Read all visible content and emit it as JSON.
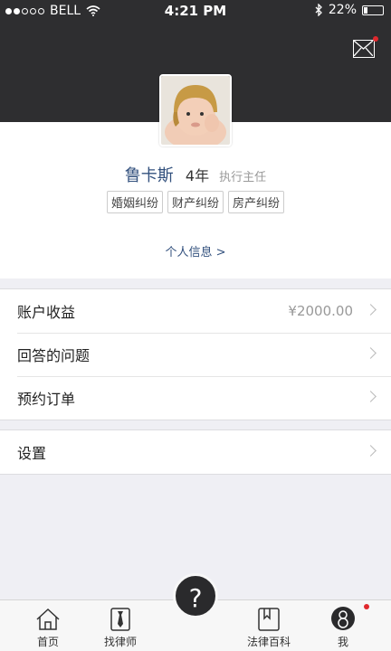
{
  "status_bar": {
    "carrier": "BELL",
    "time": "4:21 PM",
    "battery": "22%"
  },
  "header": {
    "mail_icon": "envelope-icon"
  },
  "profile": {
    "name": "鲁卡斯",
    "years": "4年",
    "title": "执行主任",
    "tags": [
      "婚姻纠纷",
      "财产纠纷",
      "房产纠纷"
    ],
    "info_link": "个人信息 >"
  },
  "menu_group1": [
    {
      "label": "账户收益",
      "value": "¥2000.00"
    },
    {
      "label": "回答的问题",
      "value": ""
    },
    {
      "label": "预约订单",
      "value": ""
    }
  ],
  "menu_group2": [
    {
      "label": "设置"
    }
  ],
  "tabs": {
    "home": "首页",
    "find_lawyer": "找律师",
    "help": "?",
    "encyclopedia": "法律百科",
    "me": "我"
  },
  "colors": {
    "header_bg": "#2e2e30",
    "accent": "#33517e",
    "badge": "#e0282d"
  }
}
